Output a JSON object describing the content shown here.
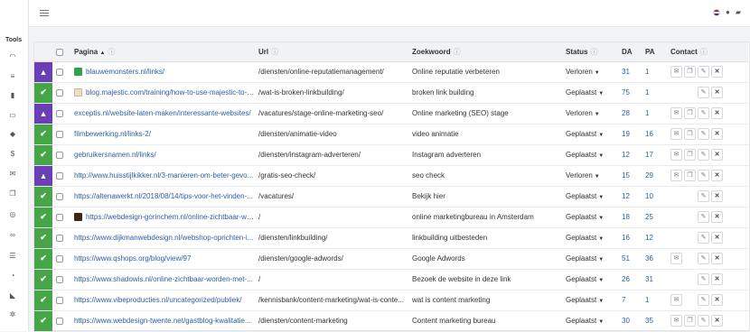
{
  "sidebar": {
    "title": "Tools",
    "icons": [
      "gauge-icon",
      "sliders-icon",
      "bar-chart-icon",
      "id-card-icon",
      "graduation-cap-icon",
      "dollar-icon",
      "envelope-icon",
      "clone-icon",
      "target-icon",
      "link-icon",
      "list-icon",
      "pie-chart-icon",
      "tag-icon",
      "gear-icon"
    ]
  },
  "topbar": {
    "icons": [
      "flag-nl-icon",
      "user-icon",
      "chat-icon"
    ]
  },
  "table": {
    "columns": {
      "pagina": "Pagina",
      "url": "Url",
      "zoekwoord": "Zoekwoord",
      "status": "Status",
      "da": "DA",
      "pa": "PA",
      "contact": "Contact"
    },
    "rows": [
      {
        "state": "warning",
        "favicon": "green",
        "pagina": "blauwemonsters.nl/links/",
        "url": "/diensten/online-reputatiemanagement/",
        "zoekwoord": "Online reputatie verbeteren",
        "status": "Verloren",
        "da": "31",
        "pa": "1",
        "contact": "mail-copy"
      },
      {
        "state": "ok",
        "favicon": "beige",
        "pagina": "blog.majestic.com/training/how-to-use-majestic-to-gain...",
        "url": "/wat-is-broken-linkbuilding/",
        "zoekwoord": "broken link building",
        "status": "Geplaatst",
        "da": "75",
        "pa": "1",
        "contact": "none"
      },
      {
        "state": "warning",
        "favicon": "none",
        "pagina": "exceptis.nl/website-laten-maken/interessante-websites/",
        "url": "/vacatures/stage-online-marketing-seo/",
        "zoekwoord": "Online marketing (SEO) stage",
        "status": "Verloren",
        "da": "28",
        "pa": "1",
        "contact": "mail-copy"
      },
      {
        "state": "ok",
        "favicon": "none",
        "pagina": "filmbewerking.nl/links-2/",
        "url": "/diensten/animatie-video",
        "zoekwoord": "video animatie",
        "status": "Geplaatst",
        "da": "19",
        "pa": "16",
        "contact": "mail-copy"
      },
      {
        "state": "ok",
        "favicon": "none",
        "pagina": "gebruikersnamen.nl/links/",
        "url": "/diensten/instagram-adverteren/",
        "zoekwoord": "Instagram adverteren",
        "status": "Geplaatst",
        "da": "12",
        "pa": "17",
        "contact": "mail-copy"
      },
      {
        "state": "warning",
        "favicon": "none",
        "pagina": "http://www.huisstijlkikker.nl/3-manieren-om-beter-gevo...",
        "url": "/gratis-seo-check/",
        "zoekwoord": "seo check",
        "status": "Verloren",
        "da": "15",
        "pa": "29",
        "contact": "mail-copy"
      },
      {
        "state": "ok",
        "favicon": "none",
        "pagina": "https://altenawerkt.nl/2018/08/14/tips-voor-het-vinden-...",
        "url": "/vacatures/",
        "zoekwoord": "Bekijk hier",
        "status": "Geplaatst",
        "da": "12",
        "pa": "10",
        "contact": "none"
      },
      {
        "state": "ok",
        "favicon": "dark",
        "pagina": "https://webdesign-gorinchem.nl/online-zichtbaar-worde...",
        "url": "/",
        "zoekwoord": "online marketingbureau in Amsterdam",
        "status": "Geplaatst",
        "da": "18",
        "pa": "25",
        "contact": "none"
      },
      {
        "state": "ok",
        "favicon": "none",
        "pagina": "https://www.dijkmanwebdesign.nl/webshop-oprichten-i...",
        "url": "/diensten/linkbuilding/",
        "zoekwoord": "linkbuilding uitbesteden",
        "status": "Geplaatst",
        "da": "16",
        "pa": "12",
        "contact": "none"
      },
      {
        "state": "ok",
        "favicon": "none",
        "pagina": "https://www.qshops.org/blog/view/97",
        "url": "/diensten/google-adwords/",
        "zoekwoord": "Google Adwords",
        "status": "Geplaatst",
        "da": "51",
        "pa": "36",
        "contact": "mail"
      },
      {
        "state": "ok",
        "favicon": "none",
        "pagina": "https://www.shadowis.nl/online-zichtbaar-worden-met-...",
        "url": "/",
        "zoekwoord": "Bezoek de website in deze link",
        "status": "Geplaatst",
        "da": "26",
        "pa": "31",
        "contact": "none"
      },
      {
        "state": "ok",
        "favicon": "none",
        "pagina": "https://www.vibeproducties.nl/uncategorized/publiek/",
        "url": "/kennisbank/content-marketing/wat-is-conte...",
        "zoekwoord": "wat is content marketing",
        "status": "Geplaatst",
        "da": "7",
        "pa": "1",
        "contact": "mail"
      },
      {
        "state": "ok",
        "favicon": "none",
        "pagina": "https://www.webdesign-twente.net/gastblog-kwalitatie...",
        "url": "/diensten/content-marketing",
        "zoekwoord": "Content marketing bureau",
        "status": "Geplaatst",
        "da": "30",
        "pa": "35",
        "contact": "mail-copy"
      }
    ]
  }
}
